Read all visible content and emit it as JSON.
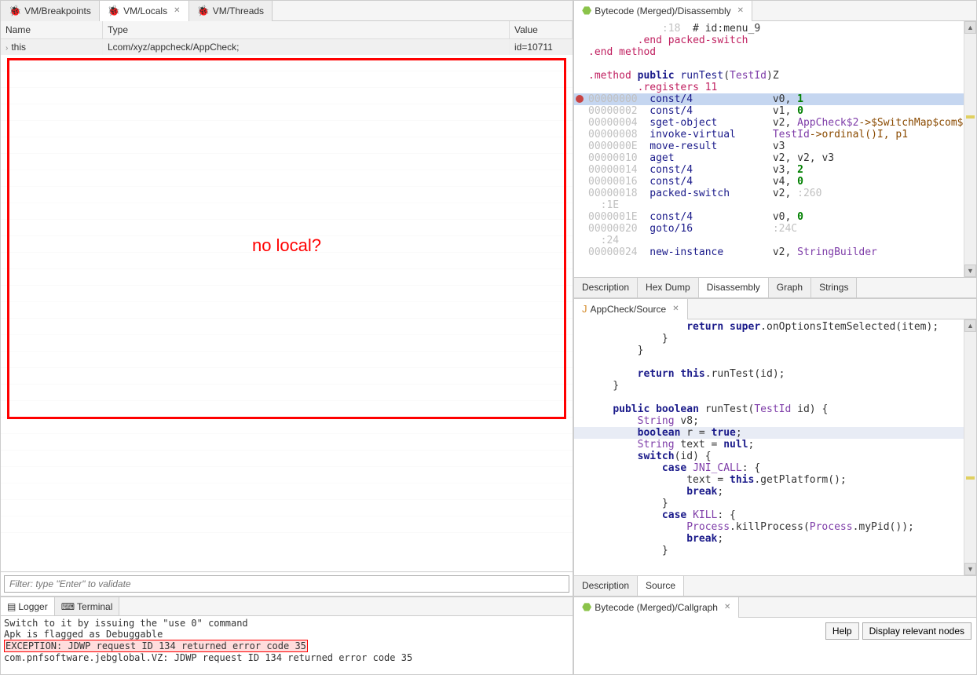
{
  "disasm": {
    "tab_title": "Bytecode (Merged)/Disassembly",
    "bottom_tabs": [
      "Description",
      "Hex Dump",
      "Disassembly",
      "Graph",
      "Strings"
    ],
    "active_bottom": 2,
    "lines": [
      {
        "pre": "            ",
        "addr": ":18",
        "rest": "  # id:menu_9"
      },
      {
        "pre": "        ",
        "dir": ".end packed-switch"
      },
      {
        "pre": "",
        "dir": ".end method"
      },
      {
        "blank": true
      },
      {
        "method_line": true,
        "visibility": "public",
        "name": "runTest",
        "sig": "(TestId)Z"
      },
      {
        "pre": "        ",
        "dir": ".registers 11",
        "reg_count": "11"
      },
      {
        "addr": "00000000",
        "op": "const/4",
        "args": "v0, ",
        "num": "1",
        "bp": true,
        "hl": "sel"
      },
      {
        "addr": "00000002",
        "op": "const/4",
        "args": "v1, ",
        "num": "0"
      },
      {
        "addr": "00000004",
        "op": "sget-object",
        "args": "v2, ",
        "ref": "AppCheck$2",
        "rest": "->$SwitchMap$com$xyz$appcheck$TestId:[I"
      },
      {
        "addr": "00000008",
        "op": "invoke-virtual",
        "ref": "TestId",
        "rest": "->ordinal()I, p1"
      },
      {
        "addr": "0000000E",
        "op": "move-result",
        "args": "v3"
      },
      {
        "addr": "00000010",
        "op": "aget",
        "args": "v2, v2, v3"
      },
      {
        "addr": "00000014",
        "op": "const/4",
        "args": "v3, ",
        "num": "2"
      },
      {
        "addr": "00000016",
        "op": "const/4",
        "args": "v4, ",
        "num": "0"
      },
      {
        "addr": "00000018",
        "op": "packed-switch",
        "args": "v2, ",
        "lbl": ":260"
      },
      {
        "pre": "  ",
        "addr": ":1E"
      },
      {
        "addr": "0000001E",
        "op": "const/4",
        "args": "v0, ",
        "num": "0"
      },
      {
        "addr": "00000020",
        "op": "goto/16",
        "lbl": ":24C"
      },
      {
        "pre": "  ",
        "addr": ":24"
      },
      {
        "addr": "00000024",
        "op": "new-instance",
        "args": "v2, ",
        "ref": "StringBuilder"
      }
    ]
  },
  "source": {
    "tab_title": "AppCheck/Source",
    "bottom_tabs": [
      "Description",
      "Source"
    ],
    "active_bottom": 1,
    "code": [
      "            return super.onOptionsItemSelected(item);",
      "        }",
      "    }",
      "",
      "    return this.runTest(id);",
      "}",
      "",
      "public boolean runTest(TestId id) {",
      "    String v8;",
      "    boolean r = true;",
      "    String text = null;",
      "    switch(id) {",
      "        case JNI_CALL: {",
      "            text = this.getPlatform();",
      "            break;",
      "        }",
      "        case KILL: {",
      "            Process.killProcess(Process.myPid());",
      "            break;",
      "        }"
    ],
    "hl_line": 9
  },
  "vm": {
    "tabs": [
      "VM/Breakpoints",
      "VM/Locals",
      "VM/Threads"
    ],
    "active_tab": 1,
    "cols": [
      "Name",
      "Type",
      "Value"
    ],
    "rows": [
      {
        "name": "this",
        "type": "Lcom/xyz/appcheck/AppCheck;",
        "value": "id=10711"
      }
    ],
    "annotation": "no local?",
    "filter_placeholder": "Filter: type \"Enter\" to validate"
  },
  "logger": {
    "tabs": [
      "Logger",
      "Terminal"
    ],
    "active_tab": 0,
    "lines": [
      "Switch to it by issuing the \"use 0\" command",
      "Apk is flagged as Debuggable",
      "EXCEPTION: JDWP request ID 134 returned error code 35",
      "com.pnfsoftware.jebglobal.VZ: JDWP request ID 134 returned error code 35"
    ],
    "hl_line": 2
  },
  "callgraph": {
    "tab_title": "Bytecode (Merged)/Callgraph",
    "buttons": [
      "Help",
      "Display relevant nodes"
    ]
  }
}
